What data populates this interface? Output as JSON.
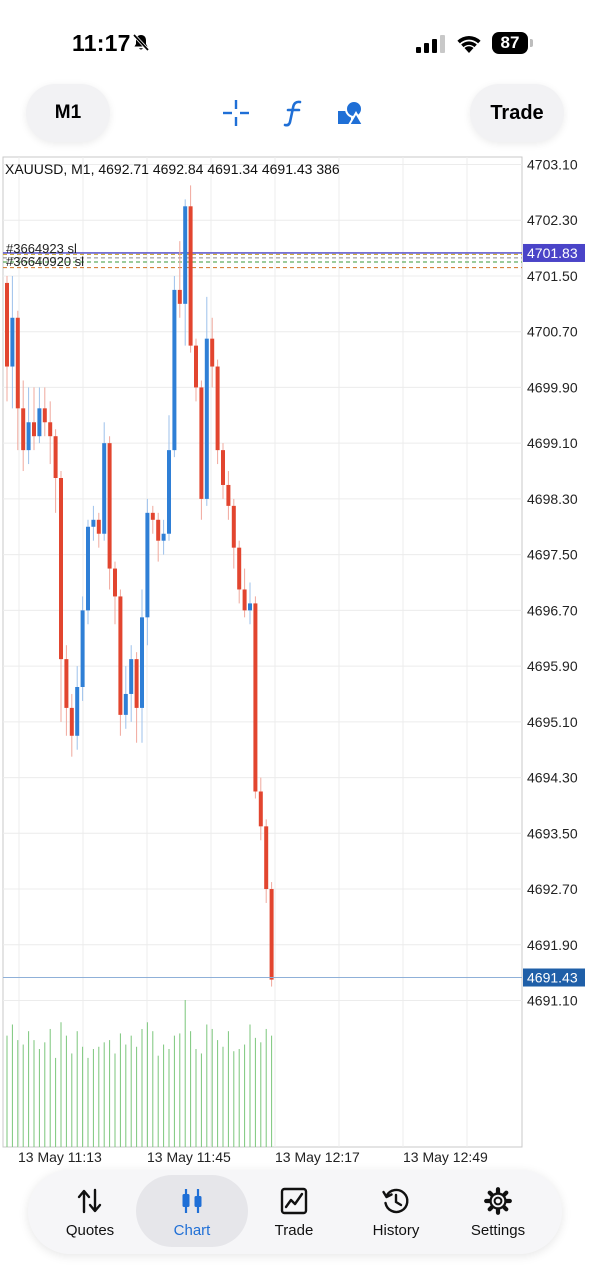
{
  "status_bar": {
    "time": "11:17",
    "battery": "87",
    "icons": [
      "bell-off-icon",
      "cellular-signal-icon",
      "wifi-icon",
      "battery-icon"
    ]
  },
  "toolbar": {
    "timeframe": "M1",
    "trade_label": "Trade",
    "icons": [
      "crosshair-icon",
      "indicators-icon",
      "objects-icon"
    ],
    "accent": "#1f6fd6"
  },
  "chart": {
    "info_line": "XAUUSD, M1, 4692.71 4692.84 4691.34 4691.43 386",
    "order_labels": [
      "#3664923 sl",
      "#36640920 sl"
    ],
    "price_labels": [
      "4703.10",
      "4702.30",
      "4701.50",
      "4700.70",
      "4699.90",
      "4699.10",
      "4698.30",
      "4697.50",
      "4696.70",
      "4695.90",
      "4695.10",
      "4694.30",
      "4693.50",
      "4692.70",
      "4691.90",
      "4691.10"
    ],
    "current_bid": "4691.43",
    "ask_line": "4701.83",
    "time_labels": [
      "13 May 11:13",
      "13 May 11:45",
      "13 May 12:17",
      "13 May 12:49"
    ],
    "colors": {
      "bull": "#2f7fd6",
      "bear": "#e2452f",
      "volume": "#7bc67b",
      "ask": "#4a44c8",
      "bid": "#1f5fa8"
    }
  },
  "chart_data": {
    "type": "candlestick",
    "symbol": "XAUUSD",
    "timeframe": "M1",
    "ylim": [
      4691.0,
      4703.1
    ],
    "x_ticks": [
      "13 May 11:13",
      "13 May 11:45",
      "13 May 12:17",
      "13 May 12:49"
    ],
    "candles": [
      [
        4701.4,
        4700.2,
        4701.5,
        4699.7
      ],
      [
        4700.2,
        4700.9,
        4701.5,
        4699.6
      ],
      [
        4700.9,
        4699.6,
        4701.0,
        4699.0
      ],
      [
        4699.6,
        4699.0,
        4700.0,
        4698.7
      ],
      [
        4699.0,
        4699.4,
        4699.9,
        4698.8
      ],
      [
        4699.4,
        4699.2,
        4699.9,
        4699.0
      ],
      [
        4699.2,
        4699.6,
        4699.9,
        4699.1
      ],
      [
        4699.6,
        4699.4,
        4699.9,
        4699.2
      ],
      [
        4699.4,
        4699.2,
        4699.7,
        4698.8
      ],
      [
        4699.2,
        4698.6,
        4699.3,
        4698.1
      ],
      [
        4698.6,
        4696.0,
        4698.7,
        4695.1
      ],
      [
        4696.0,
        4695.3,
        4696.2,
        4694.9
      ],
      [
        4695.3,
        4694.9,
        4695.5,
        4694.6
      ],
      [
        4694.9,
        4695.6,
        4695.9,
        4694.7
      ],
      [
        4695.6,
        4696.7,
        4696.9,
        4695.4
      ],
      [
        4696.7,
        4697.9,
        4698.0,
        4696.5
      ],
      [
        4697.9,
        4698.0,
        4698.2,
        4697.7
      ],
      [
        4698.0,
        4697.8,
        4698.1,
        4697.6
      ],
      [
        4697.8,
        4699.1,
        4699.4,
        4697.7
      ],
      [
        4699.1,
        4697.3,
        4699.2,
        4697.0
      ],
      [
        4697.3,
        4696.9,
        4697.4,
        4696.5
      ],
      [
        4696.9,
        4695.2,
        4697.0,
        4694.9
      ],
      [
        4695.2,
        4695.5,
        4695.9,
        4695.0
      ],
      [
        4695.5,
        4696.0,
        4696.2,
        4695.1
      ],
      [
        4696.0,
        4695.3,
        4696.1,
        4694.8
      ],
      [
        4695.3,
        4696.6,
        4697.0,
        4694.8
      ],
      [
        4696.6,
        4698.1,
        4698.3,
        4696.2
      ],
      [
        4698.1,
        4698.0,
        4698.2,
        4697.8
      ],
      [
        4698.0,
        4697.7,
        4698.1,
        4697.4
      ],
      [
        4697.7,
        4697.8,
        4698.0,
        4697.5
      ],
      [
        4697.8,
        4699.0,
        4699.5,
        4697.7
      ],
      [
        4699.0,
        4701.3,
        4701.5,
        4698.9
      ],
      [
        4701.3,
        4701.1,
        4702.0,
        4700.9
      ],
      [
        4701.1,
        4702.5,
        4702.6,
        4700.5
      ],
      [
        4702.5,
        4700.5,
        4702.8,
        4700.4
      ],
      [
        4700.5,
        4699.9,
        4700.6,
        4699.7
      ],
      [
        4699.9,
        4698.3,
        4700.0,
        4698.0
      ],
      [
        4698.3,
        4700.6,
        4701.2,
        4698.2
      ],
      [
        4700.6,
        4700.2,
        4700.9,
        4699.9
      ],
      [
        4700.2,
        4699.0,
        4700.3,
        4698.8
      ],
      [
        4699.0,
        4698.5,
        4699.1,
        4698.3
      ],
      [
        4698.5,
        4698.2,
        4698.7,
        4698.0
      ],
      [
        4698.2,
        4697.6,
        4698.3,
        4697.3
      ],
      [
        4697.6,
        4697.0,
        4697.7,
        4696.8
      ],
      [
        4697.0,
        4696.7,
        4697.3,
        4696.6
      ],
      [
        4696.7,
        4696.8,
        4697.1,
        4696.5
      ],
      [
        4696.8,
        4694.1,
        4696.9,
        4694.0
      ],
      [
        4694.1,
        4693.6,
        4694.3,
        4693.4
      ],
      [
        4693.6,
        4692.7,
        4693.7,
        4692.5
      ],
      [
        4692.7,
        4691.4,
        4692.8,
        4691.3
      ]
    ],
    "volume": [
      50,
      55,
      48,
      46,
      52,
      48,
      44,
      47,
      53,
      40,
      56,
      50,
      42,
      52,
      45,
      40,
      44,
      45,
      47,
      48,
      42,
      51,
      46,
      50,
      45,
      53,
      56,
      52,
      41,
      46,
      44,
      50,
      51,
      66,
      52,
      44,
      42,
      55,
      53,
      48,
      45,
      52,
      43,
      44,
      46,
      55,
      49,
      47,
      53,
      50
    ],
    "annotations": [
      "#3664923 sl",
      "#36640920 sl"
    ]
  },
  "nav": {
    "items": [
      {
        "label": "Quotes",
        "icon": "quotes-icon"
      },
      {
        "label": "Chart",
        "icon": "chart-icon"
      },
      {
        "label": "Trade",
        "icon": "trade-icon"
      },
      {
        "label": "History",
        "icon": "history-icon"
      },
      {
        "label": "Settings",
        "icon": "settings-icon"
      }
    ],
    "active": "Chart"
  }
}
